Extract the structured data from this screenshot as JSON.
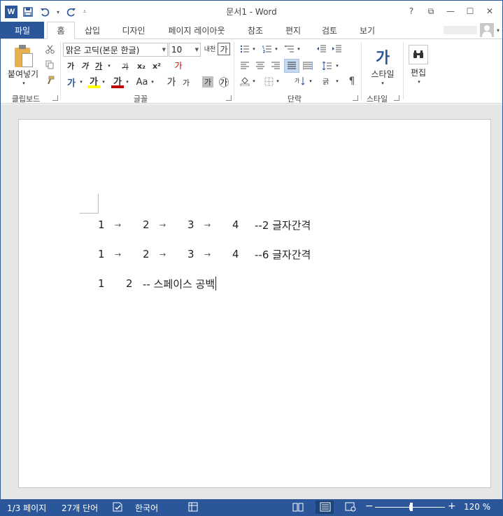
{
  "title": "문서1 - Word",
  "app_logo": "W",
  "window_controls": [
    "?",
    "⧉",
    "—",
    "☐",
    "✕"
  ],
  "file_tab": "파일",
  "tabs": [
    "홈",
    "삽입",
    "디자인",
    "페이지 레이아웃",
    "참조",
    "편지",
    "검토",
    "보기"
  ],
  "active_tab": "홈",
  "ribbon": {
    "clipboard": {
      "label": "클립보드",
      "paste": "붙여넣기"
    },
    "font": {
      "label": "글꼴",
      "font_name": "맑은 고딕(본문 한글)",
      "font_size": "10",
      "bold": "가",
      "italic": "가",
      "underline": "가",
      "strike": "가",
      "subscript": "x₂",
      "superscript": "x²",
      "text_effects": "가",
      "highlight": "가",
      "font_color": "가",
      "change_case": "Aa",
      "grow_font": "가",
      "shrink_font": "가",
      "char_shading": "가",
      "enclose_char": "㉮",
      "phonetic": "내천",
      "char_border": "가",
      "clear_format": "가"
    },
    "paragraph": {
      "label": "단락"
    },
    "styles": {
      "label": "스타일",
      "button": "스타일",
      "icon_text": "가"
    },
    "editing": {
      "button": "편집"
    }
  },
  "document": {
    "line1": {
      "nums": [
        "1",
        "2",
        "3",
        "4"
      ],
      "suffix": "--2 글자간격"
    },
    "line2": {
      "nums": [
        "1",
        "2",
        "3",
        "4"
      ],
      "suffix": "--6 글자간격"
    },
    "line3": {
      "nums": [
        "1",
        "2"
      ],
      "suffix": "-- 스페이스 공백"
    }
  },
  "status": {
    "page": "1/3 페이지",
    "words": "27개 단어",
    "language": "한국어",
    "zoom": "120 %",
    "zoom_minus": "−",
    "zoom_plus": "+"
  },
  "colors": {
    "accent": "#2b579a",
    "status_dark": "#1e4377"
  }
}
